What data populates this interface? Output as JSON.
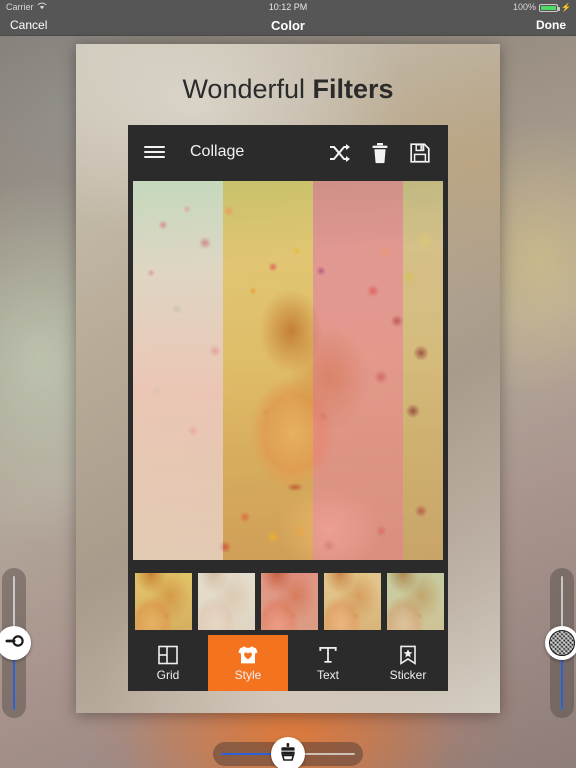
{
  "status_bar": {
    "carrier": "Carrier",
    "wifi_icon": "wifi-icon",
    "time": "10:12 PM",
    "battery_percent": "100%",
    "battery_icon": "battery-full-icon",
    "charging_icon": "lightning-bolt-icon",
    "background_color": "#565656",
    "text_color": "#d8d8d8"
  },
  "nav_bar": {
    "cancel_label": "Cancel",
    "title": "Color",
    "done_label": "Done",
    "background_color": "#565656"
  },
  "card": {
    "title_light": "Wonderful ",
    "title_bold": "Filters"
  },
  "app": {
    "toolbar": {
      "menu_icon": "hamburger-menu-icon",
      "title": "Collage",
      "shuffle_icon": "shuffle-icon",
      "delete_icon": "trash-icon",
      "save_icon": "floppy-save-icon",
      "background_color": "#2b2b2b"
    },
    "collage": {
      "subject": "woman with dried flowers",
      "panel_count": 4,
      "panels": [
        {
          "name": "panel-1",
          "tint": "green-pink",
          "width_pct": 29
        },
        {
          "name": "panel-2",
          "tint": "yellow",
          "width_pct": 29
        },
        {
          "name": "panel-3",
          "tint": "red",
          "width_pct": 29
        },
        {
          "name": "panel-4",
          "tint": "gold",
          "width_pct": 13
        }
      ]
    },
    "filter_thumbnails": [
      {
        "name": "filter-yellow",
        "overlay": "ov-yellow"
      },
      {
        "name": "filter-sepia",
        "overlay": "ov-sepia"
      },
      {
        "name": "filter-red",
        "overlay": "ov-red"
      },
      {
        "name": "filter-warm",
        "overlay": "ov-warm"
      },
      {
        "name": "filter-green",
        "overlay": "ov-green"
      }
    ],
    "tabs": [
      {
        "label": "Grid",
        "icon": "grid-layout-icon",
        "active": false
      },
      {
        "label": "Style",
        "icon": "tshirt-heart-icon",
        "active": true
      },
      {
        "label": "Text",
        "icon": "text-t-icon",
        "active": false
      },
      {
        "label": "Sticker",
        "icon": "bookmark-star-icon",
        "active": false
      }
    ],
    "active_tab_color": "#f4731f"
  },
  "sliders": {
    "left": {
      "name": "brightness-slider",
      "knob_icon": "key-icon",
      "orientation": "vertical",
      "value_pct": 50,
      "fill_color": "#2b62d8"
    },
    "right": {
      "name": "pattern-slider",
      "knob_icon": "halftone-circle-icon",
      "orientation": "vertical",
      "value_pct": 50,
      "fill_color": "#2b62d8"
    },
    "bottom": {
      "name": "brush-slider",
      "knob_icon": "paintbrush-icon",
      "orientation": "horizontal",
      "value_pct": 50,
      "fill_color": "#2b62d8"
    }
  }
}
